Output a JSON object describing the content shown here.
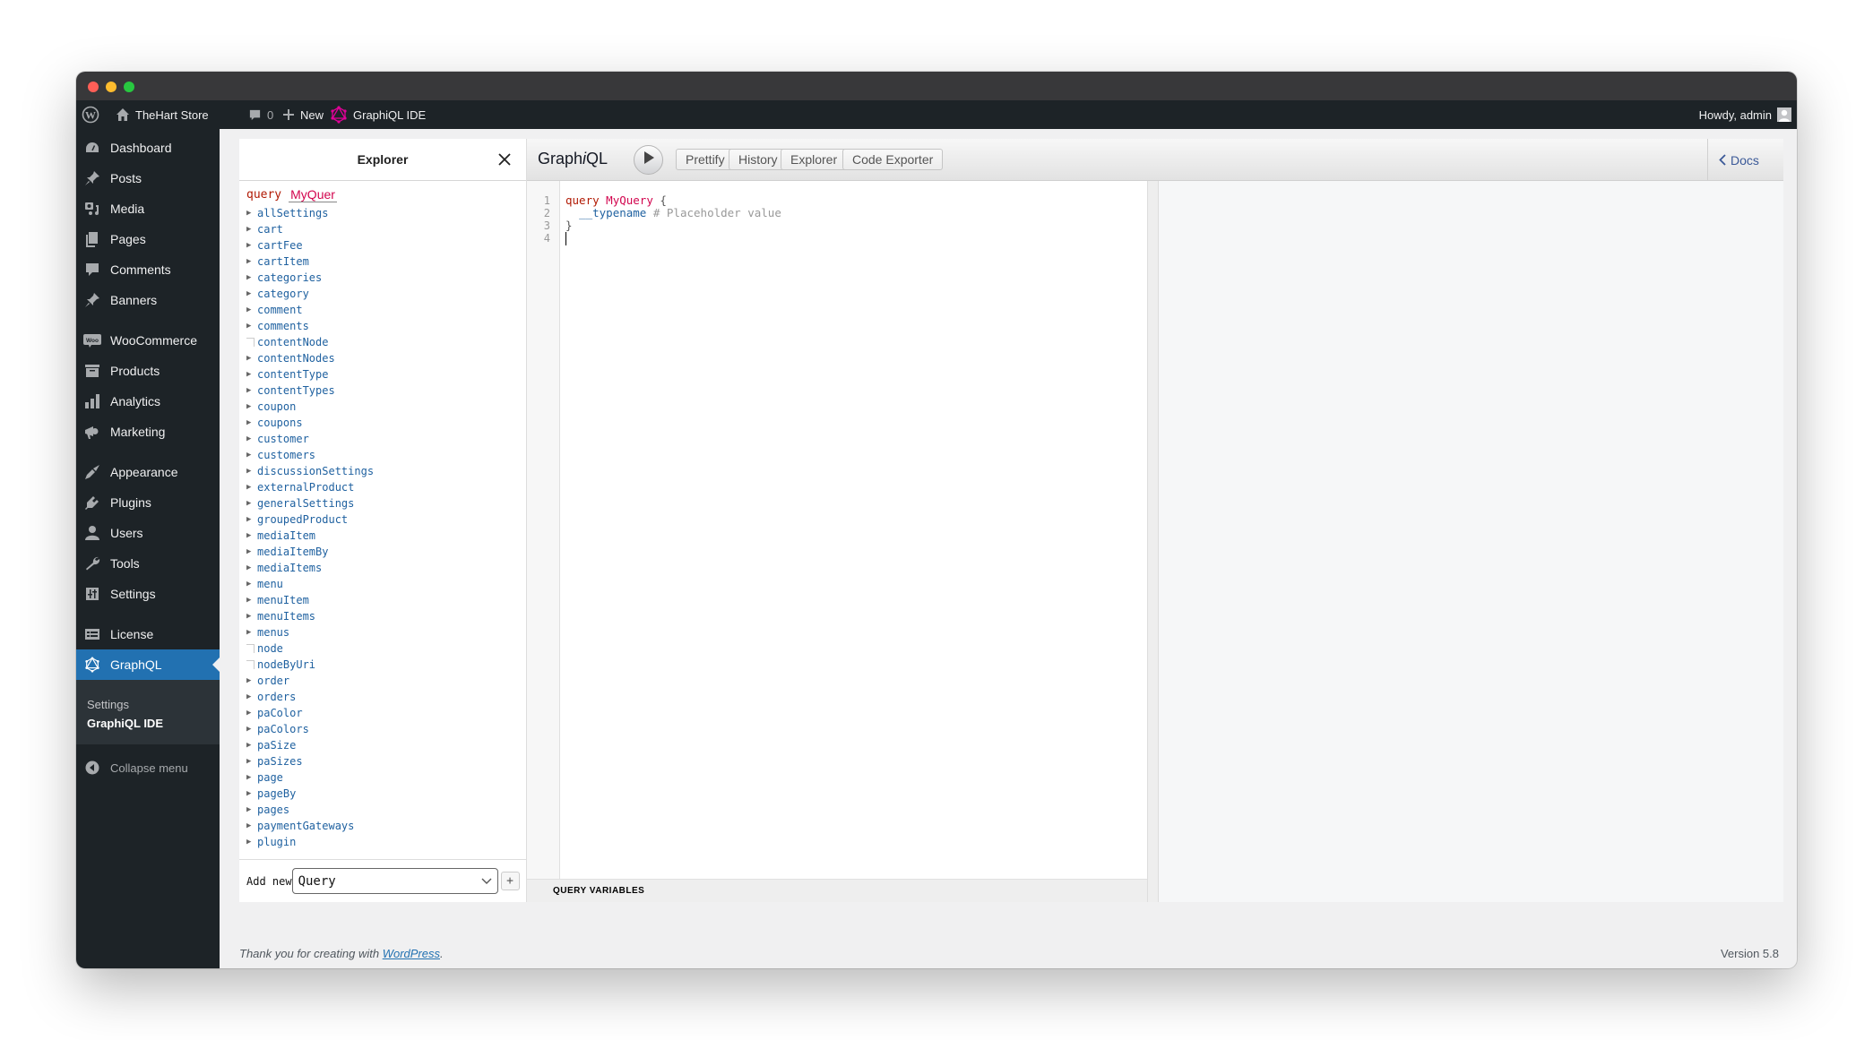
{
  "window": {
    "title": ""
  },
  "admin_bar": {
    "site_name": "TheHart Store",
    "comments_count": "0",
    "new_label": "New",
    "graphiql_label": "GraphiQL IDE",
    "greeting": "Howdy, admin"
  },
  "sidebar": {
    "items": [
      {
        "label": "Dashboard",
        "icon": "dashboard-icon"
      },
      {
        "label": "Posts",
        "icon": "pin-icon"
      },
      {
        "label": "Media",
        "icon": "media-icon"
      },
      {
        "label": "Pages",
        "icon": "pages-icon"
      },
      {
        "label": "Comments",
        "icon": "comment-icon"
      },
      {
        "label": "Banners",
        "icon": "pin-icon"
      },
      {
        "label": "WooCommerce",
        "icon": "woo-icon"
      },
      {
        "label": "Products",
        "icon": "archive-icon"
      },
      {
        "label": "Analytics",
        "icon": "bar-chart-icon"
      },
      {
        "label": "Marketing",
        "icon": "megaphone-icon"
      },
      {
        "label": "Appearance",
        "icon": "brush-icon"
      },
      {
        "label": "Plugins",
        "icon": "plug-icon"
      },
      {
        "label": "Users",
        "icon": "user-icon"
      },
      {
        "label": "Tools",
        "icon": "wrench-icon"
      },
      {
        "label": "Settings",
        "icon": "sliders-icon"
      },
      {
        "label": "License",
        "icon": "license-icon"
      },
      {
        "label": "GraphQL",
        "icon": "graphql-icon",
        "active": true
      }
    ],
    "submenu": [
      "Settings",
      "GraphiQL IDE"
    ],
    "collapse_label": "Collapse menu"
  },
  "explorer": {
    "title": "Explorer",
    "operation_keyword": "query",
    "operation_name": "MyQuer",
    "fields": [
      {
        "name": "allSettings",
        "type": "object"
      },
      {
        "name": "cart",
        "type": "object"
      },
      {
        "name": "cartFee",
        "type": "object"
      },
      {
        "name": "cartItem",
        "type": "object"
      },
      {
        "name": "categories",
        "type": "object"
      },
      {
        "name": "category",
        "type": "object"
      },
      {
        "name": "comment",
        "type": "object"
      },
      {
        "name": "comments",
        "type": "object"
      },
      {
        "name": "contentNode",
        "type": "interface"
      },
      {
        "name": "contentNodes",
        "type": "object"
      },
      {
        "name": "contentType",
        "type": "object"
      },
      {
        "name": "contentTypes",
        "type": "object"
      },
      {
        "name": "coupon",
        "type": "object"
      },
      {
        "name": "coupons",
        "type": "object"
      },
      {
        "name": "customer",
        "type": "object"
      },
      {
        "name": "customers",
        "type": "object"
      },
      {
        "name": "discussionSettings",
        "type": "object"
      },
      {
        "name": "externalProduct",
        "type": "object"
      },
      {
        "name": "generalSettings",
        "type": "object"
      },
      {
        "name": "groupedProduct",
        "type": "object"
      },
      {
        "name": "mediaItem",
        "type": "object"
      },
      {
        "name": "mediaItemBy",
        "type": "object"
      },
      {
        "name": "mediaItems",
        "type": "object"
      },
      {
        "name": "menu",
        "type": "object"
      },
      {
        "name": "menuItem",
        "type": "object"
      },
      {
        "name": "menuItems",
        "type": "object"
      },
      {
        "name": "menus",
        "type": "object"
      },
      {
        "name": "node",
        "type": "interface"
      },
      {
        "name": "nodeByUri",
        "type": "interface"
      },
      {
        "name": "order",
        "type": "object"
      },
      {
        "name": "orders",
        "type": "object"
      },
      {
        "name": "paColor",
        "type": "object"
      },
      {
        "name": "paColors",
        "type": "object"
      },
      {
        "name": "paSize",
        "type": "object"
      },
      {
        "name": "paSizes",
        "type": "object"
      },
      {
        "name": "page",
        "type": "object"
      },
      {
        "name": "pageBy",
        "type": "object"
      },
      {
        "name": "pages",
        "type": "object"
      },
      {
        "name": "paymentGateways",
        "type": "object"
      },
      {
        "name": "plugin",
        "type": "object"
      }
    ],
    "add_new_label": "Add new",
    "add_new_select_value": "Query",
    "add_button_label": "+"
  },
  "graphiql": {
    "title_prefix": "Graph",
    "title_italic": "i",
    "title_suffix": "QL",
    "buttons": {
      "prettify": "Prettify",
      "history": "History",
      "explorer": "Explorer",
      "code_exporter": "Code Exporter"
    },
    "docs_label": "Docs",
    "editor": {
      "line_numbers": [
        "1",
        "2",
        "3",
        "4"
      ],
      "lines": [
        {
          "keyword": "query",
          "name": "MyQuery",
          "punct": "{"
        },
        {
          "field": "__typename",
          "comment": "# Placeholder value"
        },
        {
          "punct": "}"
        },
        {}
      ]
    },
    "query_variables_label": "QUERY VARIABLES"
  },
  "footer": {
    "thanks_prefix": "Thank you for creating with ",
    "thanks_link": "WordPress",
    "thanks_suffix": ".",
    "version": "Version 5.8"
  },
  "colors": {
    "admin_dark": "#1d2327",
    "active_blue": "#2271b1",
    "graphql_pink": "#e10098",
    "keyword_red": "#b11a04",
    "def_pink": "#d2054e",
    "field_blue": "#1f61a0"
  }
}
